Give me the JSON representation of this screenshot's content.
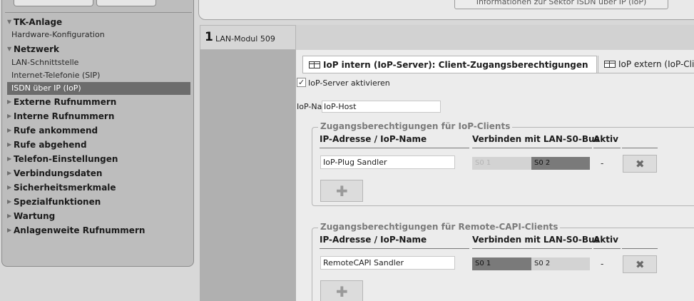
{
  "sidebar": {
    "items": [
      {
        "label": "TK-Anlage",
        "type": "head",
        "expanded": true
      },
      {
        "label": "Hardware-Konfiguration",
        "type": "sub"
      },
      {
        "label": "Netzwerk",
        "type": "head",
        "expanded": true
      },
      {
        "label": "LAN-Schnittstelle",
        "type": "sub"
      },
      {
        "label": "Internet-Telefonie (SIP)",
        "type": "sub"
      },
      {
        "label": "ISDN über IP (IoP)",
        "type": "sub",
        "active": true
      },
      {
        "label": "Externe Rufnummern",
        "type": "head"
      },
      {
        "label": "Interne Rufnummern",
        "type": "head"
      },
      {
        "label": "Rufe ankommend",
        "type": "head"
      },
      {
        "label": "Rufe abgehend",
        "type": "head"
      },
      {
        "label": "Telefon-Einstellungen",
        "type": "head"
      },
      {
        "label": "Verbindungsdaten",
        "type": "head"
      },
      {
        "label": "Sicherheitsmerkmale",
        "type": "head"
      },
      {
        "label": "Spezialfunktionen",
        "type": "head"
      },
      {
        "label": "Wartung",
        "type": "head"
      },
      {
        "label": "Anlagenweite Rufnummern",
        "type": "head"
      }
    ],
    "arrow_expanded": "▼",
    "arrow_collapsed": "▶"
  },
  "topbar": {
    "info_button": "Informationen zur Sektor ISDN über IP (IoP)"
  },
  "module": {
    "number": "1",
    "label": "LAN-Modul 509"
  },
  "tabs": {
    "intern": "IoP intern (IoP-Server): Client-Zugangsberechtigungen",
    "extern": "IoP extern (IoP-Clie"
  },
  "server": {
    "checkbox_label": "IoP-Server aktivieren",
    "checked": true,
    "name_label": "IoP-Name",
    "name_value": "IoP-Host"
  },
  "columns": {
    "ip": "IP-Adresse / IoP-Name",
    "bus": "Verbinden mit LAN-S0-Bus",
    "aktiv": "Aktiv"
  },
  "groups": {
    "iop": {
      "legend": "Zugangsberechtigungen für IoP-Clients",
      "entry": "IoP-Plug Sandler",
      "s0_1": "S0 1",
      "s0_2": "S0 2",
      "aktiv": "-"
    },
    "capi": {
      "legend": "Zugangsberechtigungen für Remote-CAPI-Clients",
      "entry": "RemoteCAPI Sandler",
      "s0_1": "S0 1",
      "s0_2": "S0 2",
      "aktiv": "-"
    }
  },
  "icons": {
    "delete": "✖",
    "add": "✚"
  },
  "colors": {
    "sidebar_bg": "#bdbdbd",
    "active_item": "#6c6c6c",
    "bus_selected": "#7a7a7a",
    "bus_unselected": "#d3d3d3",
    "main_bg": "#ececec"
  }
}
